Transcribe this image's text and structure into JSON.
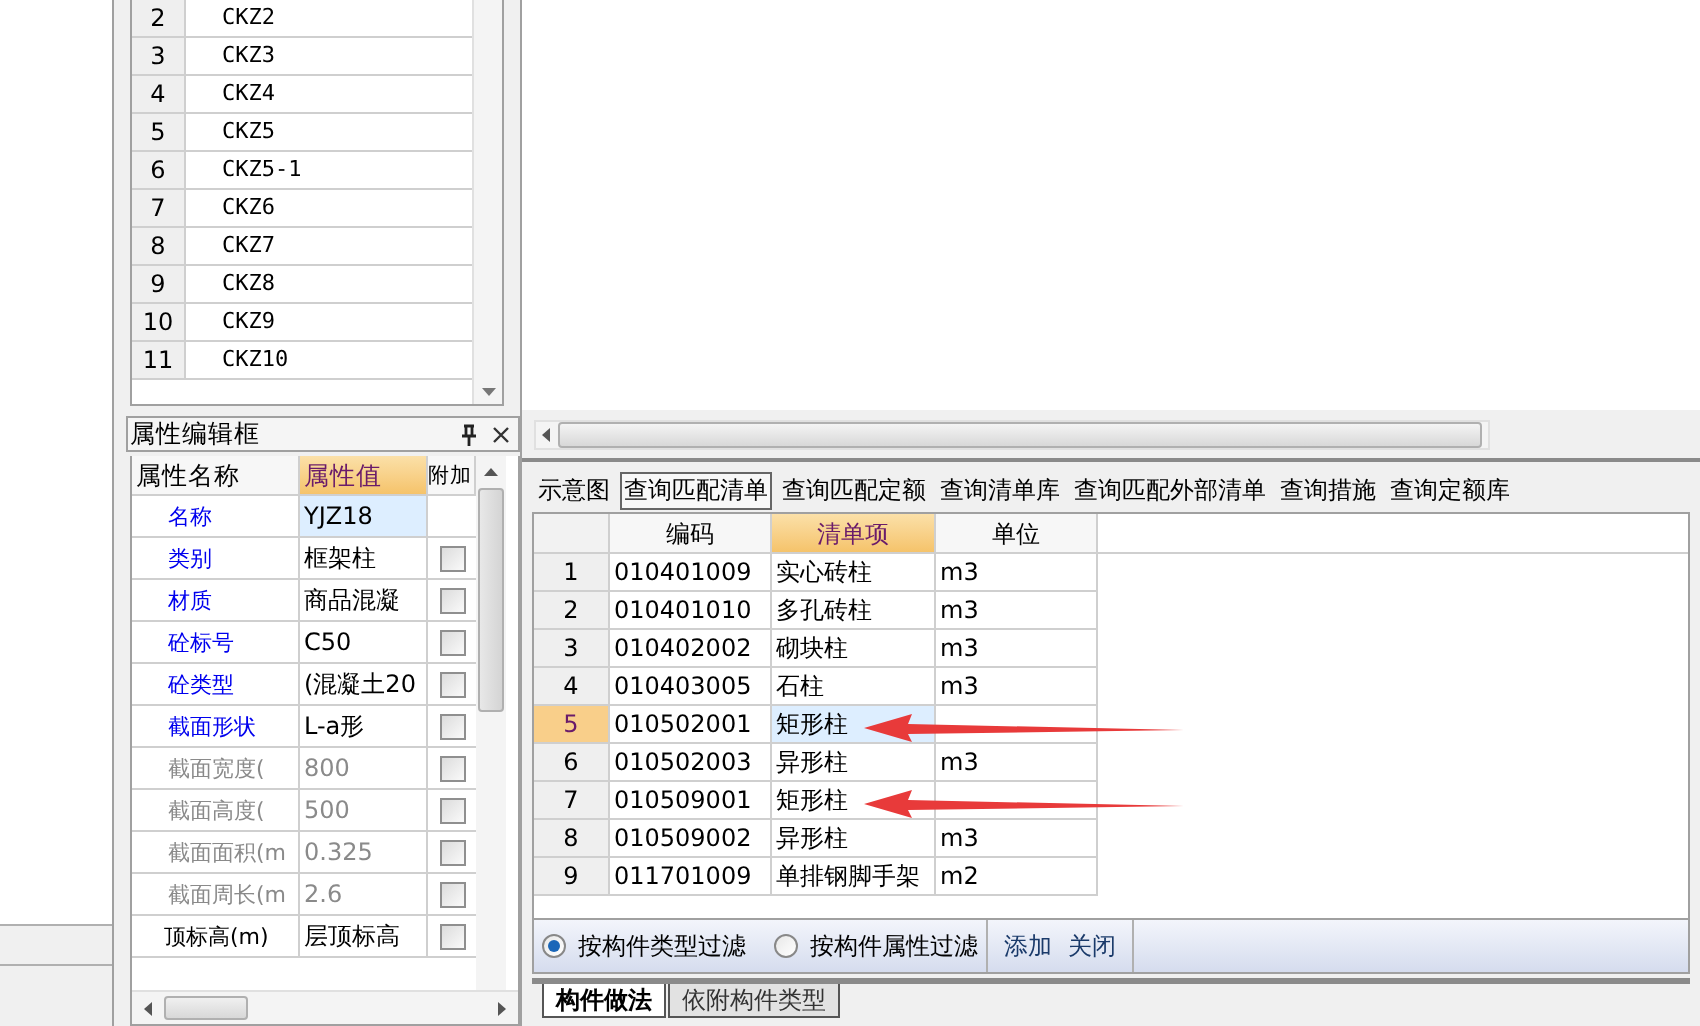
{
  "component_list": {
    "rows": [
      {
        "number": "2",
        "name": "CKZ2"
      },
      {
        "number": "3",
        "name": "CKZ3"
      },
      {
        "number": "4",
        "name": "CKZ4"
      },
      {
        "number": "5",
        "name": "CKZ5"
      },
      {
        "number": "6",
        "name": "CKZ5-1"
      },
      {
        "number": "7",
        "name": "CKZ6"
      },
      {
        "number": "8",
        "name": "CKZ7"
      },
      {
        "number": "9",
        "name": "CKZ8"
      },
      {
        "number": "10",
        "name": "CKZ9"
      },
      {
        "number": "11",
        "name": "CKZ10"
      }
    ]
  },
  "property_panel": {
    "title": "属性编辑框",
    "columns": [
      {
        "label": "属性名称",
        "selected": false
      },
      {
        "label": "属性值",
        "selected": true
      },
      {
        "label": "附加",
        "selected": false
      }
    ],
    "rows": [
      {
        "name": "名称",
        "value": "YJZ18",
        "kind": "primary",
        "selected": true
      },
      {
        "name": "类别",
        "value": "框架柱",
        "kind": "primary",
        "selected": false,
        "checked": false
      },
      {
        "name": "材质",
        "value": "商品混凝",
        "kind": "primary",
        "selected": false,
        "checked": false
      },
      {
        "name": "砼标号",
        "value": "C50",
        "kind": "primary",
        "selected": false,
        "checked": false
      },
      {
        "name": "砼类型",
        "value": "(混凝土20",
        "kind": "primary",
        "selected": false,
        "checked": false
      },
      {
        "name": "截面形状",
        "value": "L-a形",
        "kind": "primary",
        "selected": false,
        "checked": false
      },
      {
        "name": "截面宽度(",
        "value": "800",
        "kind": "disabled",
        "selected": false,
        "checked": false
      },
      {
        "name": "截面高度(",
        "value": "500",
        "kind": "disabled",
        "selected": false,
        "checked": false
      },
      {
        "name": "截面面积(m",
        "value": "0.325",
        "kind": "disabled",
        "selected": false,
        "checked": false
      },
      {
        "name": "截面周长(m",
        "value": "2.6",
        "kind": "disabled",
        "selected": false,
        "checked": false
      },
      {
        "name": "顶标高(m)",
        "value": "层顶标高",
        "kind": "plain",
        "selected": false,
        "checked": false
      }
    ]
  },
  "query_tabs": [
    {
      "label": "示意图",
      "selected": false
    },
    {
      "label": "查询匹配清单",
      "selected": true
    },
    {
      "label": "查询匹配定额",
      "selected": false
    },
    {
      "label": "查询清单库",
      "selected": false
    },
    {
      "label": "查询匹配外部清单",
      "selected": false
    },
    {
      "label": "查询措施",
      "selected": false
    },
    {
      "label": "查询定额库",
      "selected": false
    }
  ],
  "bill_table": {
    "columns": [
      {
        "label": "编码",
        "selected": false
      },
      {
        "label": "清单项",
        "selected": true
      },
      {
        "label": "单位",
        "selected": false
      }
    ],
    "rows": [
      {
        "number": "1",
        "code": "010401009",
        "item": "实心砖柱",
        "unit": "m3",
        "selected": false,
        "arrow": false
      },
      {
        "number": "2",
        "code": "010401010",
        "item": "多孔砖柱",
        "unit": "m3",
        "selected": false,
        "arrow": false
      },
      {
        "number": "3",
        "code": "010402002",
        "item": "砌块柱",
        "unit": "m3",
        "selected": false,
        "arrow": false
      },
      {
        "number": "4",
        "code": "010403005",
        "item": "石柱",
        "unit": "m3",
        "selected": false,
        "arrow": false
      },
      {
        "number": "5",
        "code": "010502001",
        "item": "矩形柱",
        "selected": true,
        "arrow": true
      },
      {
        "number": "6",
        "code": "010502003",
        "item": "异形柱",
        "unit": "m3",
        "selected": false,
        "arrow": false
      },
      {
        "number": "7",
        "code": "010509001",
        "item": "矩形柱",
        "selected": false,
        "arrow": true
      },
      {
        "number": "8",
        "code": "010509002",
        "item": "异形柱",
        "unit": "m3",
        "selected": false,
        "arrow": false
      },
      {
        "number": "9",
        "code": "011701009",
        "item": "单排钢脚手架",
        "unit": "m2",
        "selected": false,
        "arrow": false
      }
    ]
  },
  "filters": [
    {
      "label": "按构件类型过滤",
      "selected": true
    },
    {
      "label": "按构件属性过滤",
      "selected": false
    }
  ],
  "actions": [
    "添加",
    "关闭"
  ],
  "bottom_tabs": [
    {
      "label": "构件做法",
      "selected": true
    },
    {
      "label": "依附构件类型",
      "selected": false
    }
  ]
}
